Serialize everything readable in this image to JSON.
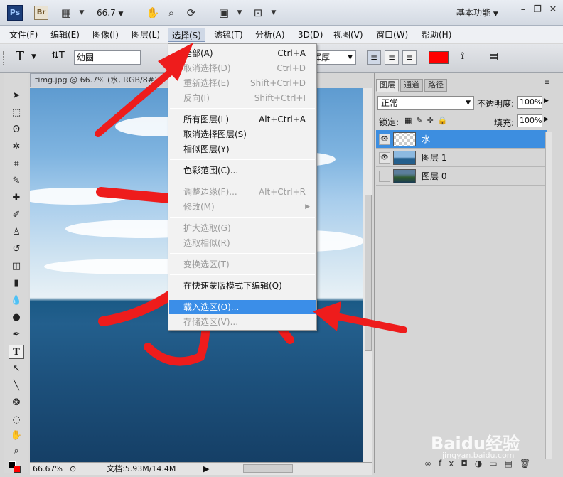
{
  "appbar": {
    "ps_logo": "Ps",
    "br_logo": "Br",
    "zoom": "66.7",
    "workspace": "基本功能",
    "icons": [
      "film-icon",
      "hand-icon",
      "zoom-icon",
      "rotate-view-icon",
      "arrange-icon",
      "screen-mode-icon"
    ],
    "window_buttons": [
      "minimize-icon",
      "restore-icon",
      "close-icon"
    ]
  },
  "menubar": {
    "items": [
      "文件(F)",
      "编辑(E)",
      "图像(I)",
      "图层(L)",
      "选择(S)",
      "滤镜(T)",
      "分析(A)",
      "3D(D)",
      "视图(V)",
      "窗口(W)",
      "帮助(H)"
    ],
    "active_index": 4
  },
  "options": {
    "tool_glyph": "T",
    "font_name": "幼圆",
    "antialias": "浑厚",
    "color": "#ff0000"
  },
  "document": {
    "tab_title": "timg.jpg @ 66.7% (水, RGB/8#)",
    "zoom_status": "66.67%",
    "doc_info": "文档:5.93M/14.4M"
  },
  "layers_panel": {
    "tabs": [
      "图层",
      "通道",
      "路径"
    ],
    "blend_mode": "正常",
    "opacity_label": "不透明度:",
    "opacity_value": "100%",
    "lock_label": "锁定:",
    "fill_label": "填充:",
    "fill_value": "100%",
    "layers": [
      {
        "name": "水",
        "visible": true,
        "selected": true
      },
      {
        "name": "图层 1",
        "visible": true,
        "selected": false
      },
      {
        "name": "图层 0",
        "visible": false,
        "selected": false
      }
    ]
  },
  "select_menu": {
    "items": [
      {
        "label": "全部(A)",
        "shortcut": "Ctrl+A",
        "enabled": true
      },
      {
        "label": "取消选择(D)",
        "shortcut": "Ctrl+D",
        "enabled": false
      },
      {
        "label": "重新选择(E)",
        "shortcut": "Shift+Ctrl+D",
        "enabled": false
      },
      {
        "label": "反向(I)",
        "shortcut": "Shift+Ctrl+I",
        "enabled": false
      },
      {
        "label": "所有图层(L)",
        "shortcut": "Alt+Ctrl+A",
        "enabled": true
      },
      {
        "label": "取消选择图层(S)",
        "shortcut": "",
        "enabled": true
      },
      {
        "label": "相似图层(Y)",
        "shortcut": "",
        "enabled": true
      },
      {
        "label": "色彩范围(C)...",
        "shortcut": "",
        "enabled": true
      },
      {
        "label": "调整边缘(F)...",
        "shortcut": "Alt+Ctrl+R",
        "enabled": false
      },
      {
        "label": "修改(M)",
        "shortcut": "",
        "enabled": false,
        "submenu": true
      },
      {
        "label": "扩大选取(G)",
        "shortcut": "",
        "enabled": false
      },
      {
        "label": "选取相似(R)",
        "shortcut": "",
        "enabled": false
      },
      {
        "label": "变换选区(T)",
        "shortcut": "",
        "enabled": false
      },
      {
        "label": "在快速蒙版模式下编辑(Q)",
        "shortcut": "",
        "enabled": true
      },
      {
        "label": "载入选区(O)...",
        "shortcut": "",
        "enabled": true,
        "highlighted": true
      },
      {
        "label": "存储选区(V)...",
        "shortcut": "",
        "enabled": false
      }
    ]
  },
  "watermark": {
    "brand": "Baidu经验",
    "url": "jingyan.baidu.com"
  },
  "annotation_color": "#ee1c1c"
}
